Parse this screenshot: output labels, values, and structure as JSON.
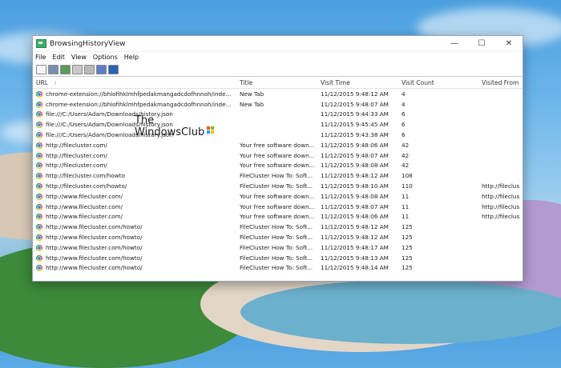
{
  "window": {
    "title": "BrowsingHistoryView",
    "controls": {
      "minimize": "—",
      "maximize": "☐",
      "close": "✕"
    }
  },
  "menu": [
    "File",
    "Edit",
    "View",
    "Options",
    "Help"
  ],
  "toolbar_icons": [
    "open-icon",
    "save-icon",
    "refresh-icon",
    "copy-icon",
    "properties-icon",
    "report-icon",
    "exit-icon"
  ],
  "columns": {
    "url": "URL",
    "sort": "/",
    "title": "Title",
    "visit_time": "Visit Time",
    "visit_count": "Visit Count",
    "visited_from": "Visited From"
  },
  "watermark": {
    "line1": "The",
    "line2": "WindowsClub"
  },
  "rows": [
    {
      "url": "chrome-extension://bhlofihklmhfpedakmangadcdofhnnoh/inde...",
      "title": "New Tab",
      "time": "11/12/2015 9:48:12 AM",
      "count": "4",
      "from": ""
    },
    {
      "url": "chrome-extension://bhlofihklmhfpedakmangadcdofhnnoh/inde...",
      "title": "New Tab",
      "time": "11/12/2015 9:48:07 AM",
      "count": "4",
      "from": ""
    },
    {
      "url": "file:///C:/Users/Adam/Downloads/history.json",
      "title": "",
      "time": "11/12/2015 9:44:33 AM",
      "count": "6",
      "from": ""
    },
    {
      "url": "file:///C:/Users/Adam/Downloads/history.json",
      "title": "",
      "time": "11/12/2015 9:45:45 AM",
      "count": "6",
      "from": ""
    },
    {
      "url": "file:///C:/Users/Adam/Downloads/history.json",
      "title": "",
      "time": "11/12/2015 9:43:38 AM",
      "count": "6",
      "from": ""
    },
    {
      "url": "http://filecluster.com/",
      "title": "Your free software down...",
      "time": "11/12/2015 9:48:06 AM",
      "count": "42",
      "from": ""
    },
    {
      "url": "http://filecluster.com/",
      "title": "Your free software down...",
      "time": "11/12/2015 9:48:07 AM",
      "count": "42",
      "from": ""
    },
    {
      "url": "http://filecluster.com/",
      "title": "Your free software down...",
      "time": "11/12/2015 9:48:08 AM",
      "count": "42",
      "from": ""
    },
    {
      "url": "http://filecluster.com/howto",
      "title": "FileCluster How To: Soft...",
      "time": "11/12/2015 9:48:12 AM",
      "count": "108",
      "from": ""
    },
    {
      "url": "http://filecluster.com/howto/",
      "title": "FileCluster How To: Soft...",
      "time": "11/12/2015 9:48:10 AM",
      "count": "110",
      "from": "http://fileclus"
    },
    {
      "url": "http://www.filecluster.com/",
      "title": "Your free software down...",
      "time": "11/12/2015 9:48:08 AM",
      "count": "11",
      "from": "http://fileclus"
    },
    {
      "url": "http://www.filecluster.com/",
      "title": "Your free software down...",
      "time": "11/12/2015 9:48:07 AM",
      "count": "11",
      "from": "http://fileclus"
    },
    {
      "url": "http://www.filecluster.com/",
      "title": "Your free software down...",
      "time": "11/12/2015 9:48:06 AM",
      "count": "11",
      "from": "http://fileclus"
    },
    {
      "url": "http://www.filecluster.com/howto/",
      "title": "FileCluster How To: Soft...",
      "time": "11/12/2015 9:48:12 AM",
      "count": "125",
      "from": ""
    },
    {
      "url": "http://www.filecluster.com/howto/",
      "title": "FileCluster How To: Soft...",
      "time": "11/12/2015 9:48:12 AM",
      "count": "125",
      "from": ""
    },
    {
      "url": "http://www.filecluster.com/howto/",
      "title": "FileCluster How To: Soft...",
      "time": "11/12/2015 9:48:17 AM",
      "count": "125",
      "from": ""
    },
    {
      "url": "http://www.filecluster.com/howto/",
      "title": "FileCluster How To: Soft...",
      "time": "11/12/2015 9:48:13 AM",
      "count": "125",
      "from": ""
    },
    {
      "url": "http://www.filecluster.com/howto/",
      "title": "FileCluster How To: Soft...",
      "time": "11/12/2015 9:48:14 AM",
      "count": "125",
      "from": ""
    }
  ]
}
